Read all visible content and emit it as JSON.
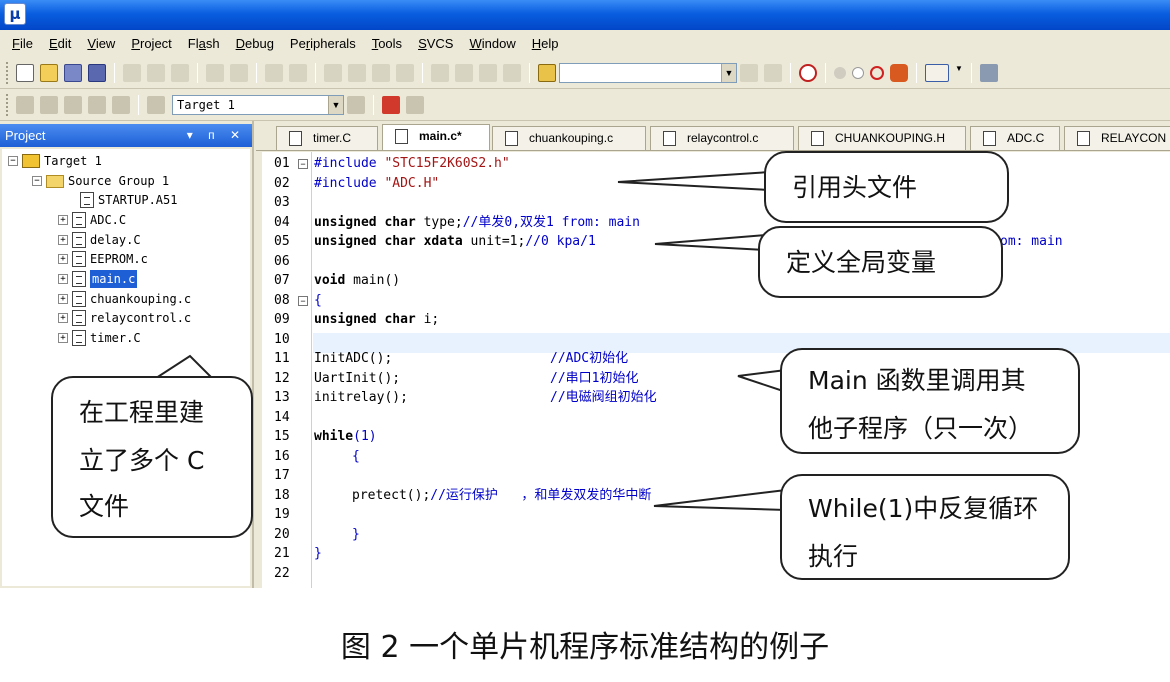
{
  "menu": [
    "File",
    "Edit",
    "View",
    "Project",
    "Flash",
    "Debug",
    "Peripherals",
    "Tools",
    "SVCS",
    "Window",
    "Help"
  ],
  "menu_mnemonics": [
    "F",
    "E",
    "V",
    "P",
    "a",
    "D",
    "r",
    "T",
    "S",
    "W",
    "H"
  ],
  "toolbar2": {
    "target_select": "Target 1"
  },
  "project": {
    "title": "Project",
    "controls": "▾ ᴨ ✕",
    "target": "Target 1",
    "group": "Source Group 1",
    "files": [
      "STARTUP.A51",
      "ADC.C",
      "delay.C",
      "EEPROM.c",
      "main.c",
      "chuankouping.c",
      "relaycontrol.c",
      "timer.C"
    ]
  },
  "tabs": [
    "timer.C",
    "main.c*",
    "chuankouping.c",
    "relaycontrol.c",
    "CHUANKOUPING.H",
    "ADC.C",
    "RELAYCON"
  ],
  "active_tab": 1,
  "code": {
    "line_numbers": [
      "01",
      "02",
      "03",
      "04",
      "05",
      "06",
      "07",
      "08",
      "09",
      "10",
      "11",
      "12",
      "13",
      "14",
      "15",
      "16",
      "17",
      "18",
      "19",
      "20",
      "21",
      "22"
    ],
    "l01": "#include ",
    "l01s": "\"STC15F2K60S2.h\"",
    "l02": "#include ",
    "l02s": "\"ADC.H\"",
    "l04k": "unsigned char ",
    "l04v": "type;",
    "l04c": "//单发0,双发1 from: main",
    "l05k": "unsigned char xdata ",
    "l05v": "unit=1;",
    "l05c": "//0 kpa/1",
    "l05tail": "om: main",
    "l07k": "void ",
    "l07v": "main()",
    "l08": "{",
    "l09k": "unsigned char ",
    "l09v": "i;",
    "l11v": "InitADC();",
    "l11c": "//ADC初始化",
    "l12v": "UartInit();",
    "l12c": "//串口1初始化",
    "l13v": "initrelay();",
    "l13c": "//电磁阀组初始化",
    "l15k": "while",
    "l15v": "(1)",
    "l16": "{",
    "l18v": "pretect();",
    "l18c": "//运行保护   ，和单发双发的华中断",
    "l20": "}",
    "l21": "}"
  },
  "callouts": {
    "header": "引用头文件",
    "globals": "定义全局变量",
    "main_line1": "Main  函数里调用其",
    "main_line2": "他子程序（只一次）",
    "while_line1": "While(1)中反复循环",
    "while_line2": "执行",
    "files_line1": "在工程里建",
    "files_line2": "立了多个 C",
    "files_line3": "文件"
  },
  "caption": "图 2  一个单片机程序标准结构的例子"
}
